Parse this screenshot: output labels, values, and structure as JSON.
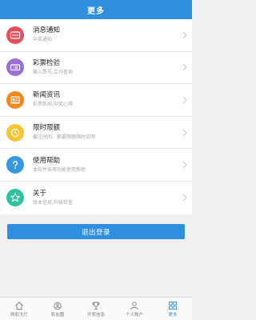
{
  "header": {
    "title": "更多"
  },
  "menu": [
    {
      "title": "消息通知",
      "subtitle": "中奖通知",
      "icon": "message-icon",
      "color": "#ea4e5c"
    },
    {
      "title": "彩票检验",
      "subtitle": "输入票号,立马查询",
      "icon": "ticket-check-icon",
      "color": "#9a6fd0"
    },
    {
      "title": "新闻资讯",
      "subtitle": "彩票新闻,中奖心得",
      "icon": "news-icon",
      "color": "#f4881f"
    },
    {
      "title": "限时限额",
      "subtitle": "截注时间、都要限额限时说明",
      "icon": "clock-icon",
      "color": "#f4c533"
    },
    {
      "title": "使用帮助",
      "subtitle": "本软件各项功能使用帮助",
      "icon": "help-icon",
      "color": "#3a98e0"
    },
    {
      "title": "关于",
      "subtitle": "版本信息,升级检查",
      "icon": "star-icon",
      "color": "#2fc29f"
    }
  ],
  "logout": {
    "label": "退出登录"
  },
  "tabs": [
    {
      "label": "购彩大厅",
      "icon": "home-icon",
      "active": false
    },
    {
      "label": "彩友圈",
      "icon": "community-icon",
      "active": false
    },
    {
      "label": "开奖信息",
      "icon": "trophy-icon",
      "active": false
    },
    {
      "label": "个人账户",
      "icon": "user-icon",
      "active": false
    },
    {
      "label": "更多",
      "icon": "grid-icon",
      "active": true
    }
  ],
  "colors": {
    "accent": "#2f8fde",
    "tab_inactive": "#7c7c7c"
  }
}
